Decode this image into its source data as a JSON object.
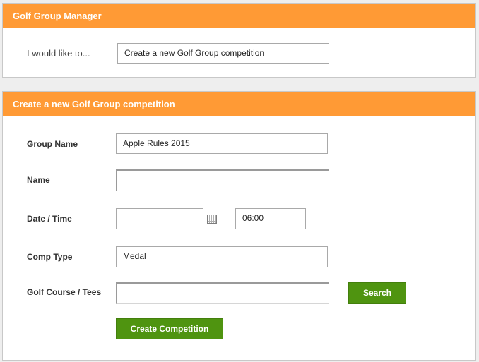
{
  "header_panel": {
    "title": "Golf Group Manager",
    "prompt_label": "I would like to...",
    "action_select_value": "Create a new Golf Group competition"
  },
  "form_panel": {
    "title": "Create a new Golf Group competition",
    "fields": {
      "group_name": {
        "label": "Group Name",
        "value": "Apple Rules 2015"
      },
      "name": {
        "label": "Name",
        "value": ""
      },
      "date_time": {
        "label": "Date / Time",
        "date_value": "",
        "time_value": "06:00"
      },
      "comp_type": {
        "label": "Comp Type",
        "value": "Medal"
      },
      "golf_course": {
        "label": "Golf Course / Tees",
        "value": ""
      }
    },
    "search_button": "Search",
    "create_button": "Create Competition"
  },
  "icons": {
    "calendar": "calendar-icon"
  },
  "colors": {
    "header_orange": "#ff9a35",
    "button_green": "#4f9410",
    "page_background": "#eeeeee"
  }
}
